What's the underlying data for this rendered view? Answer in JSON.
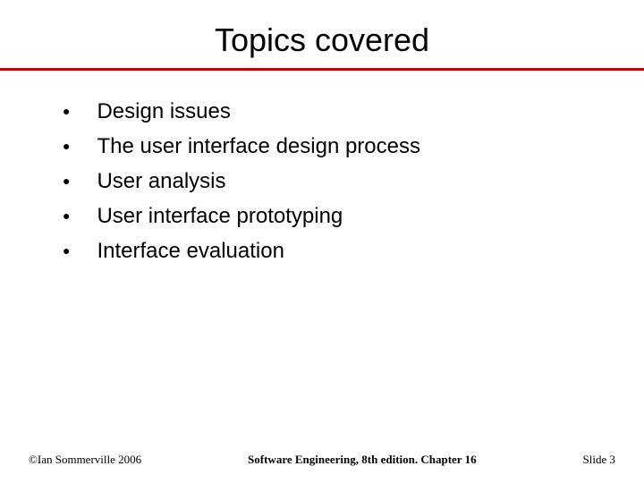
{
  "title": "Topics covered",
  "bullets": [
    "Design issues",
    "The user interface design process",
    "User analysis",
    "User interface prototyping",
    "Interface evaluation"
  ],
  "footer": {
    "left": "©Ian Sommerville 2006",
    "center": "Software Engineering, 8th edition. Chapter 16",
    "right": "Slide 3"
  }
}
